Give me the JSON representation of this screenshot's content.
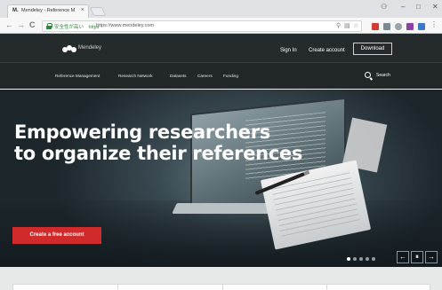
{
  "browser": {
    "tab_favicon": "M.",
    "tab_title": "Mendeley - Reference M",
    "tab_close": "×",
    "window_controls": {
      "user": "⚇",
      "minimize": "–",
      "maximize": "□",
      "close": "✕"
    },
    "nav": {
      "back": "←",
      "forward": "→",
      "reload": "C"
    },
    "security_label": "安全性が高い　https",
    "url": "https://www.mendeley.com",
    "omnibox_icons": [
      "zoom-icon",
      "translate-icon",
      "star-icon"
    ]
  },
  "header": {
    "logo_text": "Mendeley",
    "sign_in": "Sign In",
    "create_account": "Create account",
    "download": "Download"
  },
  "nav": {
    "items": [
      "Reference Management",
      "Research Network",
      "Datasets",
      "Careers",
      "Funding"
    ],
    "search_label": "Search"
  },
  "hero": {
    "headline_line1": "Empowering researchers",
    "headline_line2": "to organize their references",
    "cta_label": "Create a free account",
    "carousel_dots": 5,
    "active_dot": 0,
    "controls": {
      "prev": "←",
      "pause": "⏸",
      "next": "→"
    }
  },
  "colors": {
    "header_bg": "#252a2d",
    "cta_red": "#d12a2a",
    "secure_green": "#2e8b3a"
  }
}
